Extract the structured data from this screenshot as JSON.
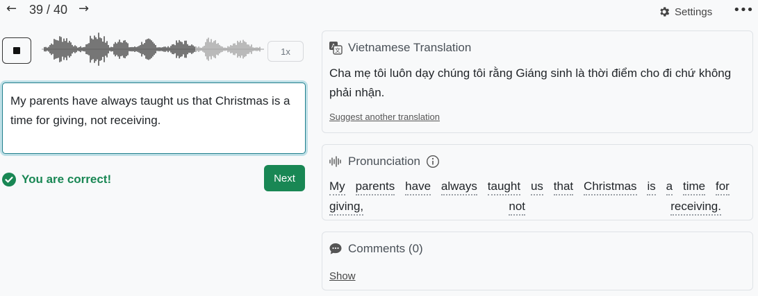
{
  "nav": {
    "prev_icon": "arrow-left-icon",
    "next_icon": "arrow-right-icon",
    "counter": "39 / 40"
  },
  "header": {
    "settings_label": "Settings",
    "more_icon": "more-horizontal-icon"
  },
  "player": {
    "stop_icon": "stop-icon",
    "speed": "1x"
  },
  "answer": {
    "value": "My parents have always taught us that Christmas is a time for giving, not receiving."
  },
  "feedback": {
    "status": "You are correct!",
    "next_label": "Next",
    "success_color": "#198754"
  },
  "translation": {
    "title": "Vietnamese Translation",
    "text": "Cha mẹ tôi luôn dạy chúng tôi rằng Giáng sinh là thời điểm cho đi chứ không phải nhận.",
    "suggest_label": "Suggest another translation"
  },
  "pronunciation": {
    "title": "Pronunciation",
    "words": [
      "My",
      "parents",
      "have",
      "always",
      "taught",
      "us",
      "that",
      "Christmas",
      "is",
      "a",
      "time",
      "for",
      "giving,",
      "not",
      "receiving."
    ]
  },
  "comments": {
    "title": "Comments (0)",
    "show_label": "Show"
  }
}
